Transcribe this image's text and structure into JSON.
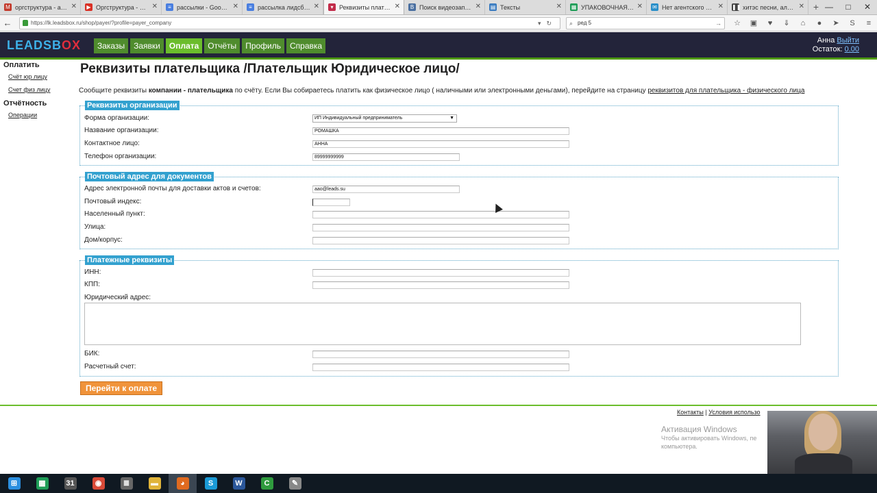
{
  "browser": {
    "tabs": [
      {
        "label": "оргструктура - ао...",
        "icon": "gmail-icon",
        "color": "#c33a2c",
        "glyph": "M"
      },
      {
        "label": "Оргструктура - Go...",
        "icon": "youtube-icon",
        "color": "#d93025",
        "glyph": "▶"
      },
      {
        "label": "рассылки - Googl...",
        "icon": "docs-icon",
        "color": "#4a7fe0",
        "glyph": "≡"
      },
      {
        "label": "рассылка лидсбо...",
        "icon": "docs-icon",
        "color": "#4a7fe0",
        "glyph": "≡"
      },
      {
        "label": "Реквизиты плател...",
        "icon": "leadsbox-icon",
        "color": "#c22c4a",
        "glyph": "▾"
      },
      {
        "label": "Поиск видеозапис...",
        "icon": "vk-icon",
        "color": "#4a6fa0",
        "glyph": "B"
      },
      {
        "label": "Тексты",
        "icon": "trello-icon",
        "color": "#3a7bc0",
        "glyph": "▤"
      },
      {
        "label": "УПАКОВОЧНАЯ ...",
        "icon": "sheets-icon",
        "color": "#1e9d57",
        "glyph": "▦"
      },
      {
        "label": "Нет агентского ка...",
        "icon": "mail-icon",
        "color": "#2a8fc9",
        "glyph": "✉"
      },
      {
        "label": "хитэс песни, альб...",
        "icon": "music-icon",
        "color": "#444444",
        "glyph": "❚❚"
      }
    ],
    "active_tab": 4,
    "url": "https://lk.leadsbox.ru/shop/payer/?profile=payer_company",
    "search": "ред 5"
  },
  "site": {
    "logo_main": "LEADSB",
    "logo_x": "OX",
    "menu": [
      "Заказы",
      "Заявки",
      "Оплата",
      "Отчёты",
      "Профиль",
      "Справка"
    ],
    "active_menu": 2,
    "user_name": "Анна",
    "logout": "Выйти",
    "balance_label": "Остаток:",
    "balance_value": "0.00"
  },
  "sidenav": {
    "pay_heading": "Оплатить",
    "pay_items": [
      "Счёт юр лицу",
      "Счет физ лицу"
    ],
    "report_heading": "Отчётность",
    "report_items": [
      "Операции"
    ]
  },
  "page": {
    "title": "Реквизиты плательщика /Плательщик Юридическое лицо/",
    "intro_a": "Сообщите реквизиты ",
    "intro_b": "компании - плательщика",
    "intro_c": " по счёту. Если Вы собираетесь платить как физическое лицо ( наличными или электронными деньгами), перейдите на страницу ",
    "intro_link": "реквизитов для плательщика - физического лица"
  },
  "org": {
    "legend": "Реквизиты организации",
    "form_label": "Форма организации:",
    "form_value": "ИП Индивидуальный предприниматель",
    "name_label": "Название организации:",
    "name_value": "РОМАШКА",
    "contact_label": "Контактное лицо:",
    "contact_value": "АННА",
    "phone_label": "Телефон организации:",
    "phone_value": "89999999999"
  },
  "postal": {
    "legend": "Почтовый адрес для документов",
    "email_label": "Адрес электронной почты для доставки актов и счетов:",
    "email_value": "aao@leads.su",
    "zip_label": "Почтовый индекс:",
    "zip_value": "",
    "city_label": "Населенный пункт:",
    "city_value": "",
    "street_label": "Улица:",
    "street_value": "",
    "house_label": "Дом/корпус:",
    "house_value": ""
  },
  "payment": {
    "legend": "Платежные реквизиты",
    "inn_label": "ИНН:",
    "kpp_label": "КПП:",
    "address_label": "Юридический адрес:",
    "bik_label": "БИК:",
    "account_label": "Расчетный счет:",
    "submit": "Перейти к оплате"
  },
  "footer": {
    "contacts": "Контакты",
    "sep": " | ",
    "terms": "Условия использо"
  },
  "overlay": {
    "activation_title": "Активация Windows",
    "activation_text": "Чтобы активировать Windows, пе компьютера."
  },
  "taskbar": [
    {
      "icon": "windows-start-icon",
      "color": "#2b8fe0",
      "glyph": "⊞"
    },
    {
      "icon": "calculator-icon",
      "color": "#1e9d57",
      "glyph": "▦"
    },
    {
      "icon": "calendar-app-icon",
      "color": "#555555",
      "glyph": "31"
    },
    {
      "icon": "chrome-icon",
      "color": "#d94a38",
      "glyph": "◉"
    },
    {
      "icon": "network-icon",
      "color": "#666666",
      "glyph": "≣"
    },
    {
      "icon": "folder-icon",
      "color": "#e0b43a",
      "glyph": "▬"
    },
    {
      "icon": "firefox-icon",
      "color": "#e06a1f",
      "glyph": "◕"
    },
    {
      "icon": "skype-icon",
      "color": "#1b9ad6",
      "glyph": "S"
    },
    {
      "icon": "word-icon",
      "color": "#2b579a",
      "glyph": "W"
    },
    {
      "icon": "camtasia-icon",
      "color": "#2f9b3e",
      "glyph": "C"
    },
    {
      "icon": "settings-app-icon",
      "color": "#888888",
      "glyph": "✎"
    }
  ],
  "taskbar_active": 6
}
